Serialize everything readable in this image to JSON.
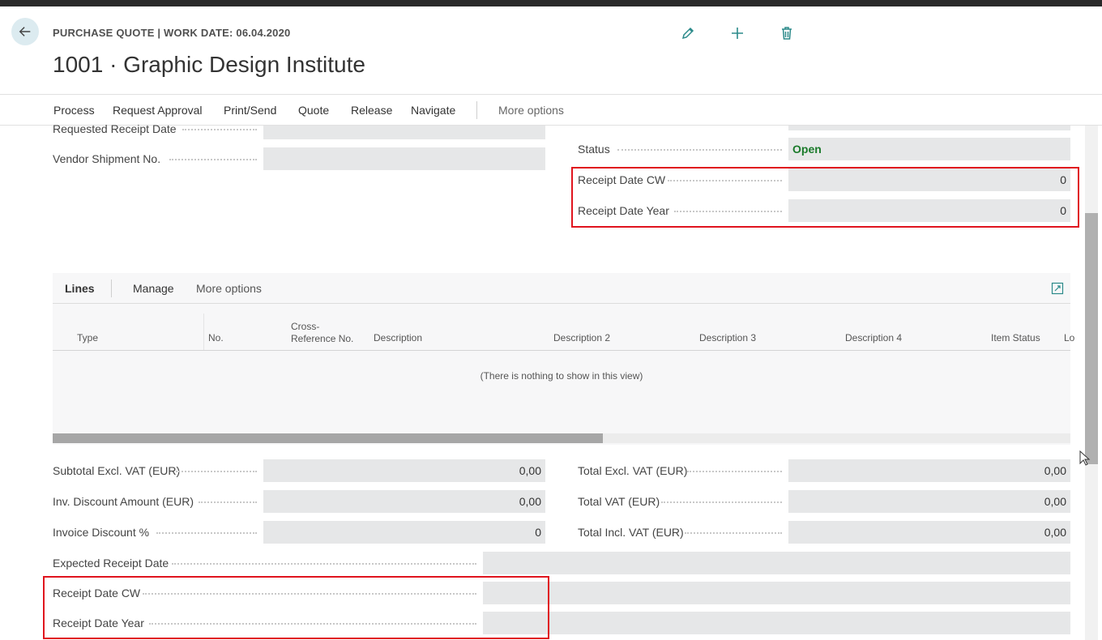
{
  "header": {
    "caption": "PURCHASE QUOTE | WORK DATE: 06.04.2020",
    "title": "1001 · Graphic Design Institute",
    "icons": [
      "back-arrow-icon",
      "pencil-icon",
      "plus-icon",
      "trash-icon"
    ]
  },
  "actionbar": {
    "items": [
      "Process",
      "Request Approval",
      "Print/Send",
      "Quote",
      "Release",
      "Navigate"
    ],
    "more": "More options"
  },
  "general": {
    "requested_receipt_date": {
      "label": "Requested Receipt Date",
      "value": ""
    },
    "vendor_shipment_no": {
      "label": "Vendor Shipment No.",
      "value": ""
    },
    "status": {
      "label": "Status",
      "value": "Open"
    },
    "receipt_date_cw": {
      "label": "Receipt Date CW",
      "value": "0"
    },
    "receipt_date_year": {
      "label": "Receipt Date Year",
      "value": "0"
    }
  },
  "lines": {
    "tabs": [
      "Lines",
      "Manage",
      "More options"
    ],
    "columns": [
      "Type",
      "No.",
      "Cross-\nReference No.",
      "Description",
      "Description 2",
      "Description 3",
      "Description 4",
      "Item Status",
      "Lo"
    ],
    "empty_message": "(There is nothing to show in this view)"
  },
  "totals": {
    "subtotal_excl_vat": {
      "label": "Subtotal Excl. VAT (EUR)",
      "value": "0,00"
    },
    "inv_discount_amount": {
      "label": "Inv. Discount Amount (EUR)",
      "value": "0,00"
    },
    "invoice_discount_pct": {
      "label": "Invoice Discount %",
      "value": "0"
    },
    "total_excl_vat": {
      "label": "Total Excl. VAT (EUR)",
      "value": "0,00"
    },
    "total_vat": {
      "label": "Total VAT (EUR)",
      "value": "0,00"
    },
    "total_incl_vat": {
      "label": "Total Incl. VAT (EUR)",
      "value": "0,00"
    }
  },
  "receipt": {
    "expected_receipt_date": {
      "label": "Expected Receipt Date",
      "value": ""
    },
    "receipt_date_cw": {
      "label": "Receipt Date CW",
      "value": ""
    },
    "receipt_date_year": {
      "label": "Receipt Date Year",
      "value": ""
    }
  },
  "colors": {
    "highlight": "#e0141e",
    "status_open": "#1a7a2a",
    "accent": "#2b8a8a"
  }
}
